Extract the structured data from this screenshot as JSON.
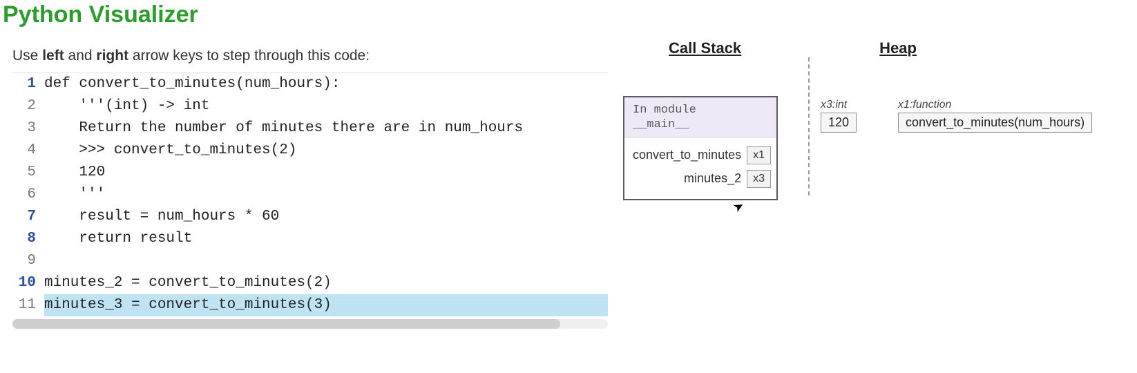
{
  "title": "Python Visualizer",
  "instructions": {
    "pre": "Use ",
    "left": "left",
    "mid": " and ",
    "right": "right",
    "post": " arrow keys to step through this code:"
  },
  "code_lines": [
    {
      "n": 1,
      "strong": true,
      "text": "def convert_to_minutes(num_hours):",
      "hl": false
    },
    {
      "n": 2,
      "strong": false,
      "text": "    '''(int) -> int",
      "hl": false
    },
    {
      "n": 3,
      "strong": false,
      "text": "    Return the number of minutes there are in num_hours",
      "hl": false
    },
    {
      "n": 4,
      "strong": false,
      "text": "    >>> convert_to_minutes(2)",
      "hl": false
    },
    {
      "n": 5,
      "strong": false,
      "text": "    120",
      "hl": false
    },
    {
      "n": 6,
      "strong": false,
      "text": "    '''",
      "hl": false
    },
    {
      "n": 7,
      "strong": true,
      "text": "    result = num_hours * 60",
      "hl": false
    },
    {
      "n": 8,
      "strong": true,
      "text": "    return result",
      "hl": false
    },
    {
      "n": 9,
      "strong": false,
      "text": "",
      "hl": false
    },
    {
      "n": 10,
      "strong": true,
      "text": "minutes_2 = convert_to_minutes(2)",
      "hl": false
    },
    {
      "n": 11,
      "strong": false,
      "text": "minutes_3 = convert_to_minutes(3)",
      "hl": true
    }
  ],
  "headers": {
    "call_stack": "Call Stack",
    "heap": "Heap"
  },
  "stack": {
    "frame_title": "In module\n__main__",
    "vars": [
      {
        "name": "convert_to_minutes",
        "ref": "x1"
      },
      {
        "name": "minutes_2",
        "ref": "x3"
      }
    ]
  },
  "heap": [
    {
      "label": "x3:int",
      "box": "120"
    },
    {
      "label": "x1:function",
      "box": "convert_to_minutes(num_hours)"
    }
  ]
}
